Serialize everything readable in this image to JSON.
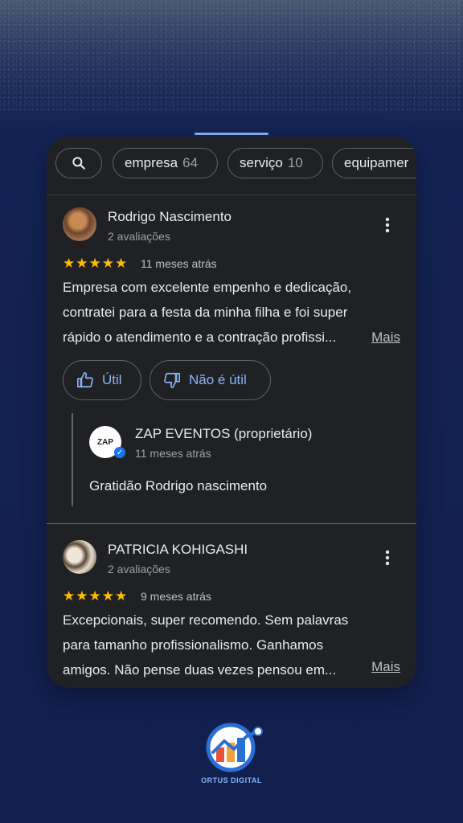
{
  "filters": {
    "search_icon": "search-icon",
    "chips": [
      {
        "label": "empresa",
        "count": "64"
      },
      {
        "label": "serviço",
        "count": "10"
      },
      {
        "label": "equipamer",
        "count": ""
      }
    ]
  },
  "reviews": [
    {
      "name": "Rodrigo Nascimento",
      "sub": "2 avaliações",
      "stars": "★★★★★",
      "rating": 5,
      "date": "11 meses atrás",
      "text_lines": [
        "Empresa com excelente empenho e dedicação,",
        "contratei para a festa da minha filha e foi super",
        "rápido o atendimento e a contração  profissi..."
      ],
      "more_label": "Mais",
      "helpful_label": "Útil",
      "not_helpful_label": "Não é útil",
      "reply": {
        "owner": "ZAP EVENTOS (proprietário)",
        "logo_text": "ZAP",
        "date": "11 meses atrás",
        "text": "Gratidão Rodrigo nascimento"
      }
    },
    {
      "name": "PATRICIA KOHIGASHI",
      "sub": "2 avaliações",
      "stars": "★★★★★",
      "rating": 5,
      "date": "9 meses atrás",
      "text_lines": [
        "Excepcionais, super recomendo. Sem palavras",
        "para tamanho  profissionalismo. Ganhamos",
        "amigos.  Não pense duas  vezes pensou em..."
      ],
      "more_label": "Mais"
    }
  ],
  "brand": {
    "name": "ORTUS DIGITAL"
  },
  "colors": {
    "accent": "#8ab4f8",
    "star": "#fbbc04",
    "card": "#202124",
    "background": "#12204f"
  }
}
